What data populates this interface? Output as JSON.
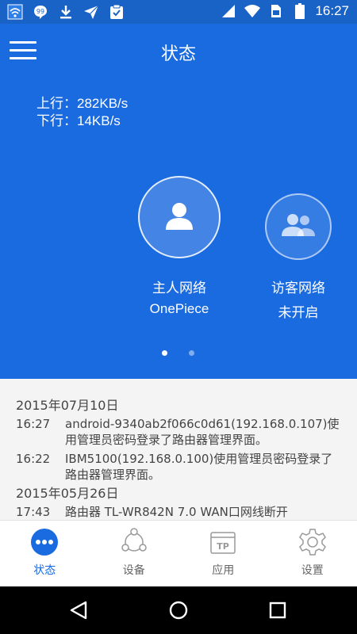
{
  "status_bar": {
    "time": "16:27",
    "left_icons": [
      "wifi-status-icon",
      "chat-bubble-icon",
      "download-icon",
      "send-icon",
      "clipboard-check-icon"
    ],
    "right_icons": [
      "signal-icon",
      "wifi-icon",
      "sim-card-icon",
      "battery-icon"
    ]
  },
  "header": {
    "title": "状态",
    "upload_speed": "上行：282KB/s",
    "download_speed": "下行：14KB/s"
  },
  "networks": {
    "host": {
      "label": "主人网络",
      "ssid": "OnePiece",
      "icon": "person-icon"
    },
    "guest": {
      "label": "访客网络",
      "status": "未开启",
      "icon": "group-icon"
    }
  },
  "pager": {
    "pages": 2,
    "active": 1
  },
  "logs": {
    "group1": {
      "date": "2015年07月10日",
      "entries": [
        {
          "time": "16:27",
          "text": "android-9340ab2f066c0d61(192.168.0.107)使用管理员密码登录了路由器管理界面。"
        },
        {
          "time": "16:22",
          "text": "IBM5100(192.168.0.100)使用管理员密码登录了路由器管理界面。"
        }
      ]
    },
    "group2": {
      "date": "2015年05月26日",
      "entries": [
        {
          "time": "17:43",
          "text": "路由器 TL-WR842N 7.0 WAN口网线断开"
        }
      ]
    }
  },
  "tabs": {
    "status": {
      "label": "状态",
      "icon": "more-dots-icon"
    },
    "devices": {
      "label": "设备",
      "icon": "devices-icon"
    },
    "apps": {
      "label": "应用",
      "icon": "tp-app-icon"
    },
    "settings": {
      "label": "设置",
      "icon": "gear-icon"
    }
  },
  "colors": {
    "primary": "#1a6ae0",
    "status_bar": "#1a63c6",
    "log_background": "#f4f4f4",
    "tab_inactive": "#666666"
  }
}
